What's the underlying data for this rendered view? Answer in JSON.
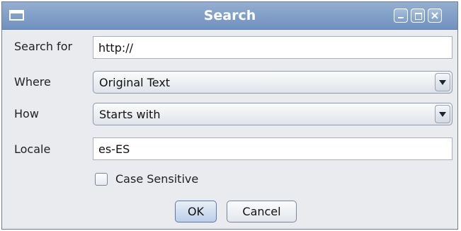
{
  "window": {
    "title": "Search",
    "icon": "window-menu-icon"
  },
  "titlebar_buttons": [
    "minimize-icon",
    "maximize-icon",
    "close-icon"
  ],
  "form": {
    "search_for": {
      "label": "Search for",
      "value": "http://"
    },
    "where": {
      "label": "Where",
      "selected": "Original Text"
    },
    "how": {
      "label": "How",
      "selected": "Starts with"
    },
    "locale": {
      "label": "Locale",
      "value": "es-ES"
    },
    "case_sensitive": {
      "label": "Case Sensitive",
      "checked": false
    }
  },
  "buttons": {
    "ok": "OK",
    "cancel": "Cancel"
  }
}
